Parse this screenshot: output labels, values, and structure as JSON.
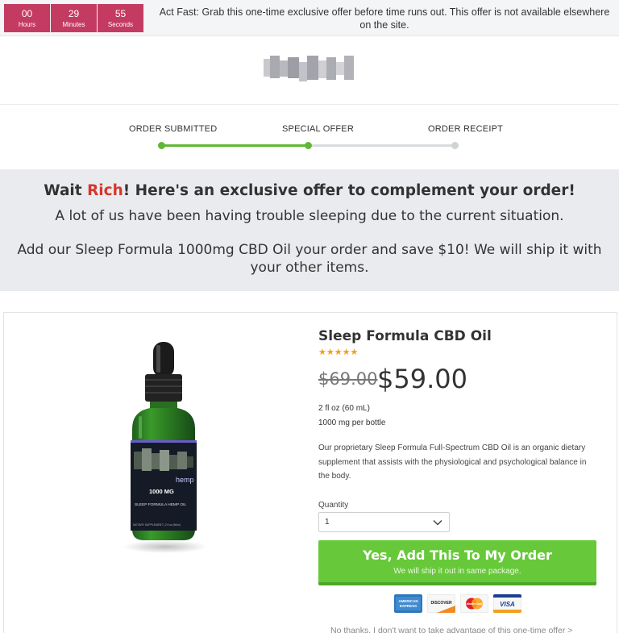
{
  "countdown": {
    "hours": {
      "value": "00",
      "unit": "Hours"
    },
    "minutes": {
      "value": "29",
      "unit": "Minutes"
    },
    "seconds": {
      "value": "55",
      "unit": "Seconds"
    },
    "message": "Act Fast: Grab this one-time exclusive offer before time runs out. This offer is not available elsewhere on the site."
  },
  "steps": {
    "items": [
      "ORDER SUBMITTED",
      "SPECIAL OFFER",
      "ORDER RECEIPT"
    ],
    "progress": 0.5
  },
  "banner": {
    "heading_before": "Wait ",
    "customer_name": "Rich",
    "heading_after": "! Here's an exclusive offer to complement your order!",
    "line2": "A lot of us have been having trouble sleeping due to the current situation.",
    "line3": "Add our Sleep Formula 1000mg CBD Oil your order and save $10! We will ship it with your other items."
  },
  "product": {
    "title": "Sleep Formula CBD Oil",
    "rating": 5,
    "stars": "★★★★★",
    "old_price": "$69.00",
    "new_price": "$59.00",
    "spec_volume": "2 fl oz (60 mL)",
    "spec_strength": "1000 mg per bottle",
    "description": "Our proprietary Sleep Formula Full-Spectrum CBD Oil is an organic dietary supplement that assists with the physiological and psychological balance in the body.",
    "bottle_label": {
      "brand": "hemp",
      "mg": "1000 MG",
      "name": "SLEEP FORMULA HEMP OIL",
      "footer": "DIETARY SUPPLEMENT | 2 fl oz (60ml)"
    }
  },
  "quantity": {
    "label": "Quantity",
    "value": "1"
  },
  "cta": {
    "main": "Yes, Add This To My Order",
    "sub": "We will ship it out in same package."
  },
  "payment_cards": [
    {
      "name": "American Express",
      "label": "AMERICAN EXPRESS"
    },
    {
      "name": "Discover",
      "label": "DISCOVER"
    },
    {
      "name": "MasterCard",
      "label": "MasterCard"
    },
    {
      "name": "Visa",
      "label": "VISA"
    }
  ],
  "decline_link": "No thanks, I don't want to take advantage of this one-time offer >",
  "colors": {
    "timer_bg": "#c43b62",
    "progress_green": "#5fb834",
    "cta_green": "#67c93a",
    "name_red": "#d3382b",
    "star_gold": "#f0a020"
  }
}
